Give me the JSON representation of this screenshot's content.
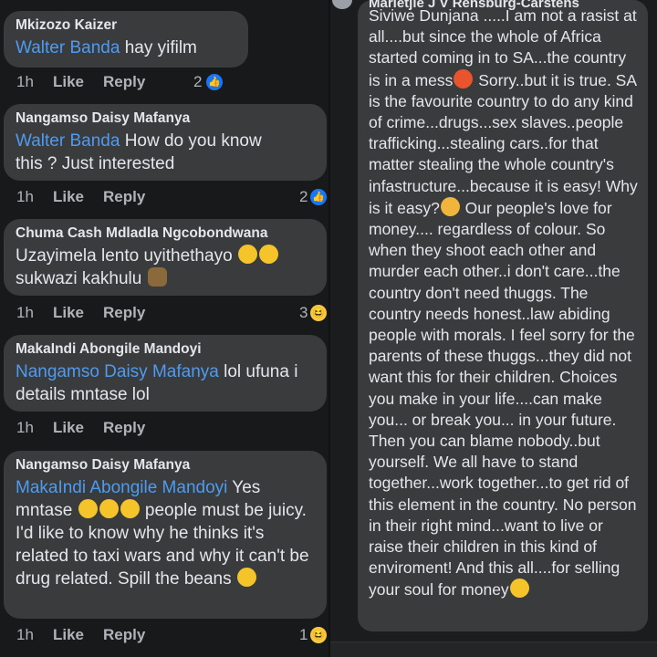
{
  "comments": [
    {
      "author": "Mkizozo Kaizer",
      "mention": "Walter Banda",
      "text": " hay yifilm",
      "time": "1h",
      "like": "Like",
      "reply": "Reply",
      "reactions": "2",
      "reaction_icon": "like-icon"
    },
    {
      "author": "Nangamso Daisy Mafanya",
      "mention": "Walter Banda",
      "text": " How do you know this ? Just interested",
      "time": "1h",
      "like": "Like",
      "reply": "Reply",
      "reactions": "2",
      "reaction_icon": "like-icon"
    },
    {
      "author": "Chuma Cash Mdladla Ngcobondwana",
      "text_line1": "Uzayimela lento uyithethayo",
      "text_line2": "sukwazi kakhulu",
      "time": "1h",
      "like": "Like",
      "reply": "Reply",
      "reactions": "3",
      "reaction_icon": "haha-icon"
    },
    {
      "author": "MakaIndi Abongile Mandoyi",
      "mention": "Nangamso Daisy Mafanya",
      "text": " lol ufuna i details mntase lol",
      "time": "1h",
      "like": "Like",
      "reply": "Reply"
    },
    {
      "author": "Nangamso Daisy Mafanya",
      "mention": "MakaIndi Abongile Mandoyi",
      "text_a": " Yes mntase",
      "text_b": " people must be juicy. I'd like to know why he thinks it's related to taxi wars and why it can't be drug related. Spill the beans",
      "time": "1h",
      "like": "Like",
      "reply": "Reply",
      "reactions": "1",
      "reaction_icon": "haha-icon"
    }
  ],
  "right_comment": {
    "author": "Marietjie J V Rensburg-Carstens",
    "part1": "Siviwe Dunjana .....I am not a rasist at all....but since the whole of Africa started coming in to SA...the country is in a mess",
    "part2": " Sorry..but it is true. SA is the favourite country to do any kind of crime...drugs...sex slaves..people trafficking...stealing cars..for that matter stealing the whole country's infastructure...because it is easy! Why is it easy?",
    "part3": " Our people's love for money.... regardless of colour. So when they shoot each other and murder each other..i don't care...the country don't need thuggs. The country needs honest..law abiding people with morals. I feel sorry for the parents of these thuggs...they did not want this for their children. Choices you make in your  life....can make you... or break you... in your future. Then you can blame nobody..but yourself. We all have to stand together...work together...to get rid of this element in the country. No person in their right mind...want to live or raise their children in this kind of enviroment! And this all....for selling your soul for money"
  },
  "colors": {
    "bubble": "#3a3b3c",
    "mention": "#4e9bf0",
    "text": "#e4e6eb",
    "meta": "#b0b3b8",
    "background": "#18191a"
  }
}
